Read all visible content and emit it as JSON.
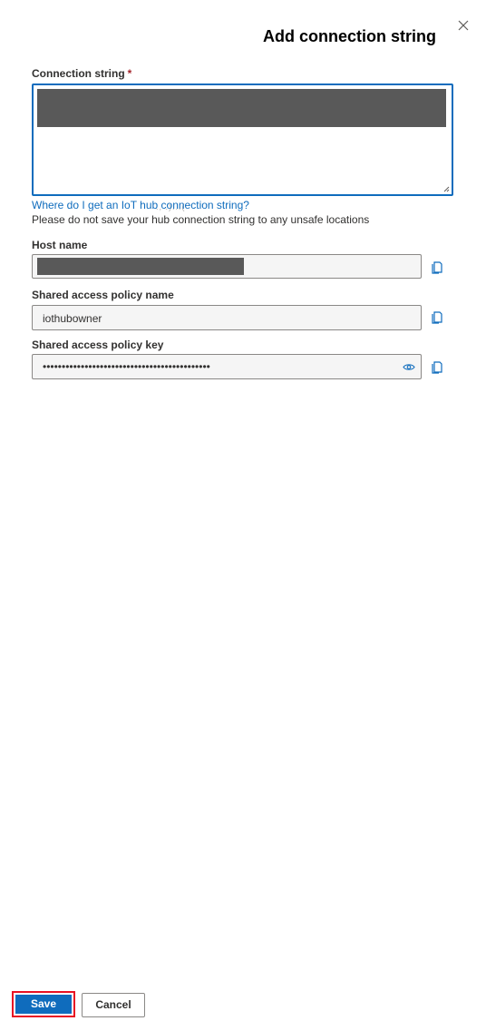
{
  "panel": {
    "title": "Add connection string",
    "close_icon": "close-icon"
  },
  "connection_string": {
    "label": "Connection string",
    "required_mark": "*",
    "value": "redacted",
    "help_link": "Where do I get an IoT hub connection string?",
    "help_text": "Please do not save your hub connection string to any unsafe locations"
  },
  "host_name": {
    "label": "Host name",
    "value": "redacted",
    "copy_icon": "copy-icon"
  },
  "policy_name": {
    "label": "Shared access policy name",
    "value": "iothubowner",
    "copy_icon": "copy-icon"
  },
  "policy_key": {
    "label": "Shared access policy key",
    "masked_value": "••••••••••••••••••••••••••••••••••••••••••••",
    "reveal_icon": "eye-icon",
    "copy_icon": "copy-icon"
  },
  "footer": {
    "save_label": "Save",
    "cancel_label": "Cancel"
  },
  "colors": {
    "accent": "#0f6cbd",
    "highlight_border": "#e81123",
    "required": "#a4262c",
    "redaction": "#595959"
  }
}
